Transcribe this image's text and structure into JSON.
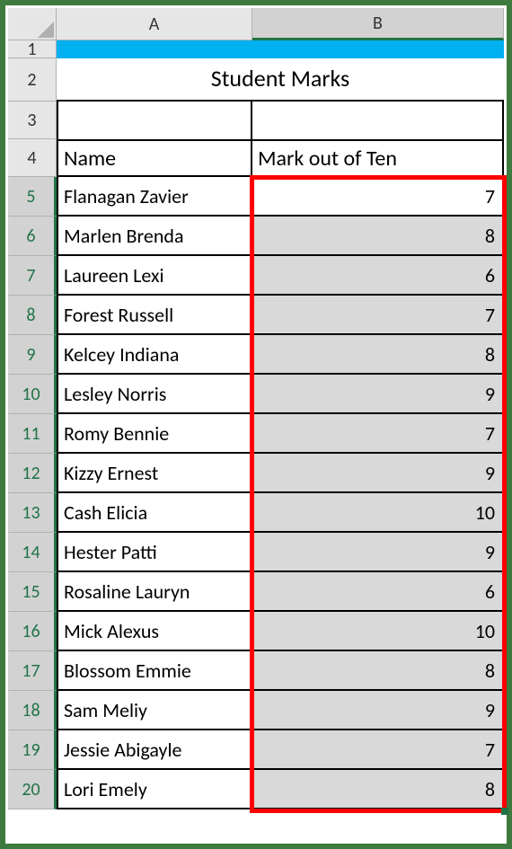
{
  "columns": {
    "a": "A",
    "b": "B"
  },
  "title": "Student Marks",
  "headers": {
    "name": "Name",
    "mark": "Mark out of Ten"
  },
  "row_labels": [
    "1",
    "2",
    "3",
    "4",
    "5",
    "6",
    "7",
    "8",
    "9",
    "10",
    "11",
    "12",
    "13",
    "14",
    "15",
    "16",
    "17",
    "18",
    "19",
    "20"
  ],
  "students": [
    {
      "name": "Flanagan Zavier",
      "mark": "7"
    },
    {
      "name": "Marlen Brenda",
      "mark": "8"
    },
    {
      "name": "Laureen Lexi",
      "mark": "6"
    },
    {
      "name": "Forest Russell",
      "mark": "7"
    },
    {
      "name": "Kelcey Indiana",
      "mark": "8"
    },
    {
      "name": "Lesley Norris",
      "mark": "9"
    },
    {
      "name": "Romy Bennie",
      "mark": "7"
    },
    {
      "name": "Kizzy Ernest",
      "mark": "9"
    },
    {
      "name": "Cash Elicia",
      "mark": "10"
    },
    {
      "name": "Hester Patti",
      "mark": "9"
    },
    {
      "name": "Rosaline Lauryn",
      "mark": "6"
    },
    {
      "name": "Mick Alexus",
      "mark": "10"
    },
    {
      "name": "Blossom Emmie",
      "mark": "8"
    },
    {
      "name": "Sam Meliy",
      "mark": "9"
    },
    {
      "name": "Jessie Abigayle",
      "mark": "7"
    },
    {
      "name": "Lori Emely",
      "mark": "8"
    }
  ],
  "chart_data": {
    "type": "table",
    "title": "Student Marks",
    "columns": [
      "Name",
      "Mark out of Ten"
    ],
    "rows": [
      [
        "Flanagan Zavier",
        7
      ],
      [
        "Marlen Brenda",
        8
      ],
      [
        "Laureen Lexi",
        6
      ],
      [
        "Forest Russell",
        7
      ],
      [
        "Kelcey Indiana",
        8
      ],
      [
        "Lesley Norris",
        9
      ],
      [
        "Romy Bennie",
        7
      ],
      [
        "Kizzy Ernest",
        9
      ],
      [
        "Cash Elicia",
        10
      ],
      [
        "Hester Patti",
        9
      ],
      [
        "Rosaline Lauryn",
        6
      ],
      [
        "Mick Alexus",
        10
      ],
      [
        "Blossom Emmie",
        8
      ],
      [
        "Sam Meliy",
        9
      ],
      [
        "Jessie Abigayle",
        7
      ],
      [
        "Lori Emely",
        8
      ]
    ]
  }
}
